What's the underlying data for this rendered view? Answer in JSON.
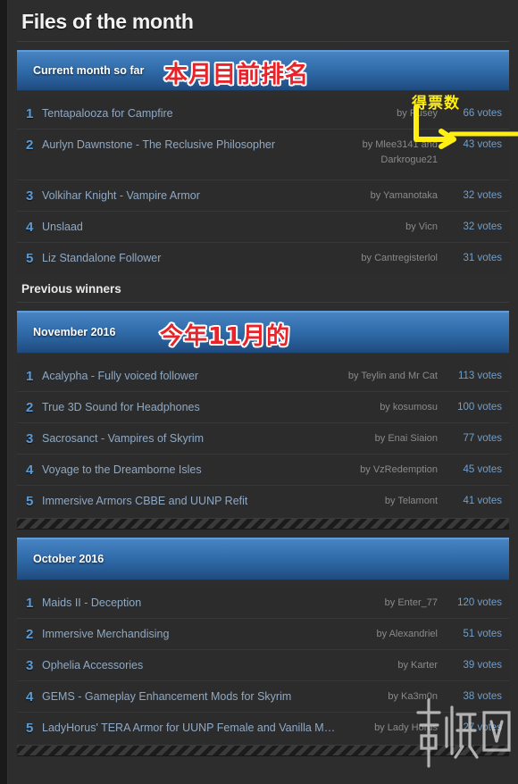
{
  "page": {
    "title": "Files of the month",
    "previous_winners_heading": "Previous winners"
  },
  "annotations": {
    "current_month_cjk": "本月目前排名",
    "november_cjk": "今年11月的",
    "votes_column_cjk": "得票数",
    "watermark": "游侠网",
    "colors": {
      "red_annotation": "#e8242a",
      "yellow_annotation": "#ffee14",
      "banner_blue": "#2f6aa8",
      "rank_blue": "#5b9bd5",
      "link_blue": "#8fa9c4",
      "votes_blue": "#6f9fcd",
      "page_background": "#2d2d2d"
    }
  },
  "sections": [
    {
      "banner_label": "Current month so far",
      "entries": [
        {
          "rank": "1",
          "name": "Tentapalooza for Campfire",
          "author": "by Rusey",
          "votes": "66 votes"
        },
        {
          "rank": "2",
          "name": "Aurlyn Dawnstone - The Reclusive Philosopher",
          "author": "by Mlee3141 and Darkrogue21",
          "votes": "43 votes"
        },
        {
          "rank": "3",
          "name": "Volkihar Knight - Vampire Armor",
          "author": "by Yamanotaka",
          "votes": "32 votes"
        },
        {
          "rank": "4",
          "name": "Unslaad",
          "author": "by Vicn",
          "votes": "32 votes"
        },
        {
          "rank": "5",
          "name": "Liz Standalone Follower",
          "author": "by Cantregisterlol",
          "votes": "31 votes"
        }
      ]
    },
    {
      "banner_label": "November 2016",
      "entries": [
        {
          "rank": "1",
          "name": "Acalypha - Fully voiced follower",
          "author": "by Teylin and Mr Cat",
          "votes": "113 votes"
        },
        {
          "rank": "2",
          "name": "True 3D Sound for Headphones",
          "author": "by kosumosu",
          "votes": "100 votes"
        },
        {
          "rank": "3",
          "name": "Sacrosanct - Vampires of Skyrim",
          "author": "by Enai Siaion",
          "votes": "77 votes"
        },
        {
          "rank": "4",
          "name": "Voyage to the Dreamborne Isles",
          "author": "by VzRedemption",
          "votes": "45 votes"
        },
        {
          "rank": "5",
          "name": "Immersive Armors CBBE and UUNP Refit",
          "author": "by Telamont",
          "votes": "41 votes"
        }
      ]
    },
    {
      "banner_label": "October 2016",
      "entries": [
        {
          "rank": "1",
          "name": "Maids II - Deception",
          "author": "by Enter_77",
          "votes": "120 votes"
        },
        {
          "rank": "2",
          "name": "Immersive Merchandising",
          "author": "by Alexandriel",
          "votes": "51 votes"
        },
        {
          "rank": "3",
          "name": "Ophelia Accessories",
          "author": "by Karter",
          "votes": "39 votes"
        },
        {
          "rank": "4",
          "name": "GEMS - Gameplay Enhancement Mods for Skyrim",
          "author": "by Ka3m0n",
          "votes": "38 votes"
        },
        {
          "rank": "5",
          "name": "LadyHorus' TERA Armor for UUNP Female and Vanilla Male",
          "author": "by Lady Horus",
          "votes": "27 votes"
        }
      ]
    }
  ]
}
